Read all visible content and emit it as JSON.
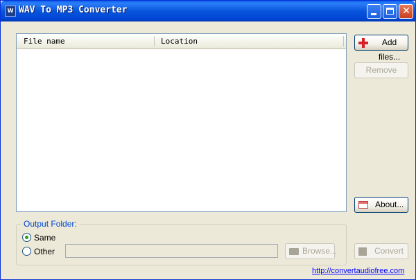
{
  "window": {
    "title": "WAV To MP3 Converter",
    "app_icon_text": "W"
  },
  "file_list": {
    "columns": [
      "File name",
      "Location"
    ],
    "rows": []
  },
  "buttons": {
    "add_files": "Add files...",
    "remove": "Remove",
    "about": "About...",
    "browse": "Browse...",
    "convert": "Convert"
  },
  "output_folder": {
    "group_label": "Output Folder:",
    "options": [
      "Same",
      "Other"
    ],
    "selected": "Same",
    "path_value": ""
  },
  "footer": {
    "link_text": "http://convertaudiofree.com"
  },
  "colors": {
    "titlebar": "#0855DD",
    "link": "#0000FF",
    "radio_checked": "#21A121"
  }
}
